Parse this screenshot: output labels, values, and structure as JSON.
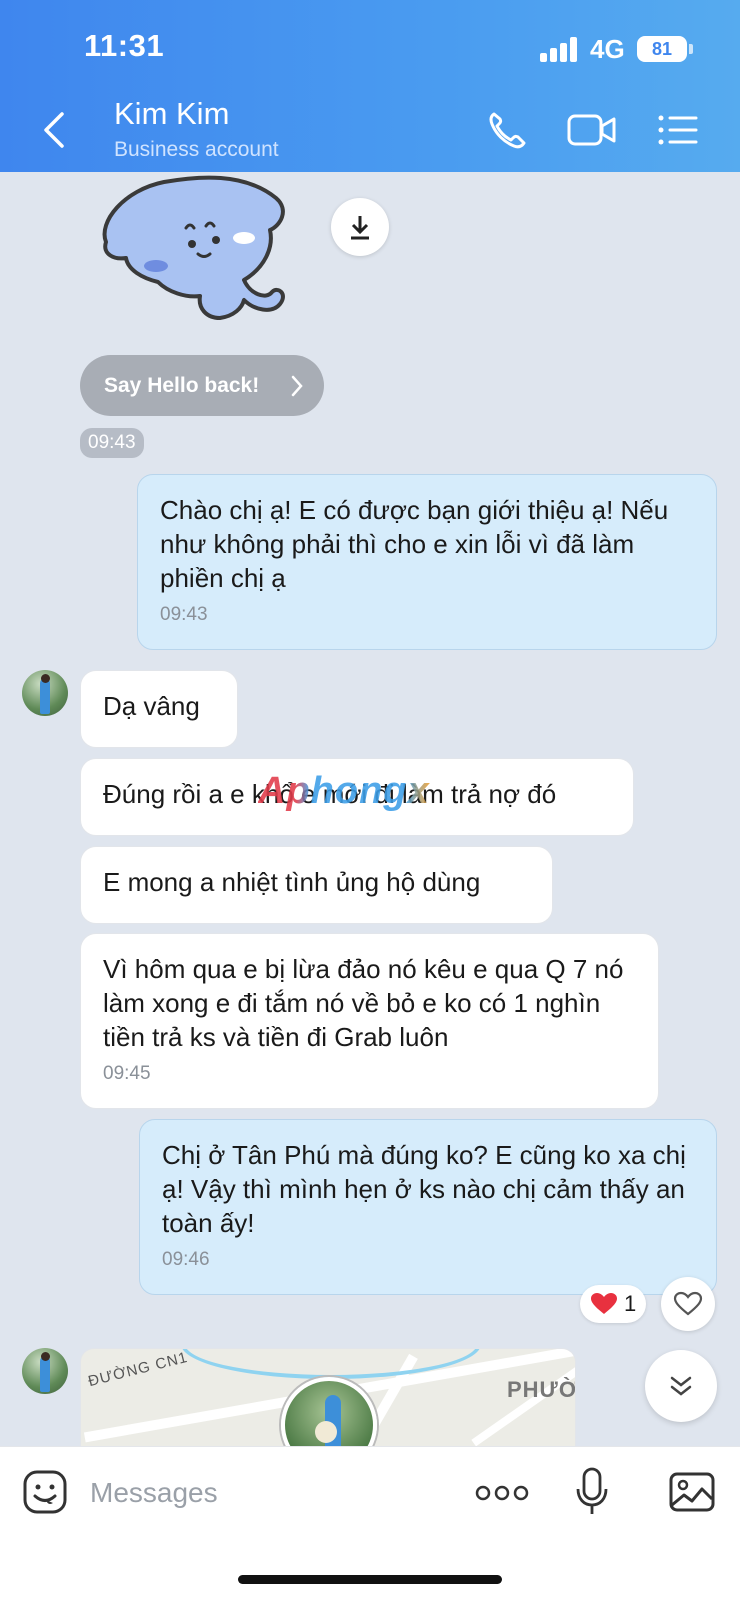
{
  "status_bar": {
    "time": "11:31",
    "network": "4G",
    "battery": "81"
  },
  "header": {
    "title": "Kim Kim",
    "subtitle": "Business account",
    "icons": [
      "back-icon",
      "phone-icon",
      "video-call-icon",
      "menu-list-icon"
    ]
  },
  "sticker_area": {
    "hello_button_label": "Say Hello back!",
    "time": "09:43"
  },
  "messages": [
    {
      "direction": "out",
      "text": "Chào chị ạ! E có được bạn giới thiệu ạ! Nếu như không phải thì cho e xin lỗi vì đã làm phiền chị ạ",
      "time": "09:43"
    },
    {
      "direction": "in",
      "text": "Dạ vâng"
    },
    {
      "direction": "in",
      "text": "Đúng rồi a e khổ e mới đi làm trả nợ đó"
    },
    {
      "direction": "in",
      "text": "E mong a nhiệt tình ủng hộ dùng"
    },
    {
      "direction": "in",
      "text": "Vì hôm qua e bị lừa đảo nó kêu e qua Q 7 nó làm xong e đi tắm nó về bỏ e ko có 1 nghìn tiền trả ks và tiền đi Grab luôn",
      "time": "09:45"
    },
    {
      "direction": "out",
      "text": "Chị ở Tân Phú mà đúng ko? E cũng ko xa chị ạ! Vậy thì mình hẹn ở ks nào chị cảm thấy an toàn ấy!",
      "time": "09:46"
    }
  ],
  "reaction": {
    "emoji": "❤️",
    "count": "1"
  },
  "watermark": "Aphongx",
  "map": {
    "street_label": "ĐƯỜNG CN1",
    "area_label": "PHƯỜ"
  },
  "composer": {
    "placeholder": "Messages"
  },
  "colors": {
    "header": "#4a9cf0",
    "outgoing_bubble": "#d6ecfb",
    "incoming_bubble": "#ffffff",
    "background": "#dfe5ee"
  }
}
